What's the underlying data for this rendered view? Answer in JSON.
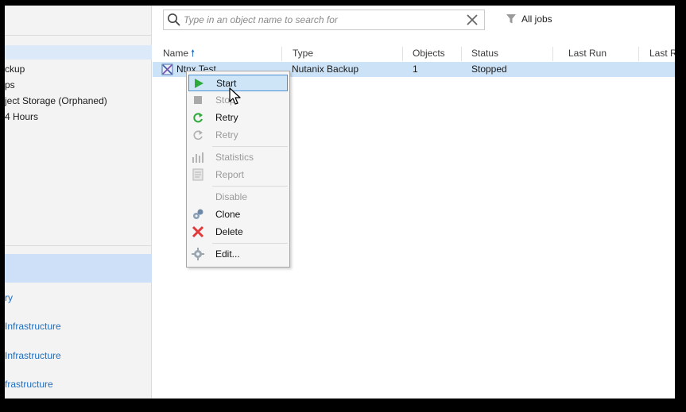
{
  "search": {
    "placeholder": "Type in an object name to search for",
    "filter_label": "All jobs"
  },
  "nav": {
    "items": [
      "ckup",
      "ps",
      "ject Storage (Orphaned)",
      "4 Hours"
    ],
    "links": [
      "ry",
      " Infrastructure",
      " Infrastructure",
      "frastructure"
    ]
  },
  "table": {
    "columns": [
      "Name",
      "Type",
      "Objects",
      "Status",
      "Last Run",
      "Last R"
    ],
    "rows": [
      {
        "name": "Ntnx Test",
        "type": "Nutanix Backup",
        "objects": "1",
        "status": "Stopped",
        "last_run": "",
        "last_r": ""
      }
    ]
  },
  "context_menu": {
    "items": [
      {
        "label": "Start",
        "icon": "play-icon",
        "enabled": true,
        "highlighted": true
      },
      {
        "label": "Stop",
        "icon": "stop-icon",
        "enabled": false
      },
      {
        "label": "Retry",
        "icon": "retry-icon",
        "enabled": true
      },
      {
        "label": "Retry",
        "icon": "retry-icon",
        "enabled": false
      },
      {
        "label": "Statistics",
        "icon": "statistics-icon",
        "enabled": false
      },
      {
        "label": "Report",
        "icon": "report-icon",
        "enabled": false
      },
      {
        "label": "Disable",
        "icon": "",
        "enabled": false
      },
      {
        "label": "Clone",
        "icon": "clone-icon",
        "enabled": true
      },
      {
        "label": "Delete",
        "icon": "delete-icon",
        "enabled": true
      },
      {
        "label": "Edit...",
        "icon": "edit-icon",
        "enabled": true
      }
    ]
  },
  "colors": {
    "selection": "#cce2f7",
    "link": "#1f6fbf",
    "play": "#2eaa3c",
    "delete": "#e03a3a"
  }
}
